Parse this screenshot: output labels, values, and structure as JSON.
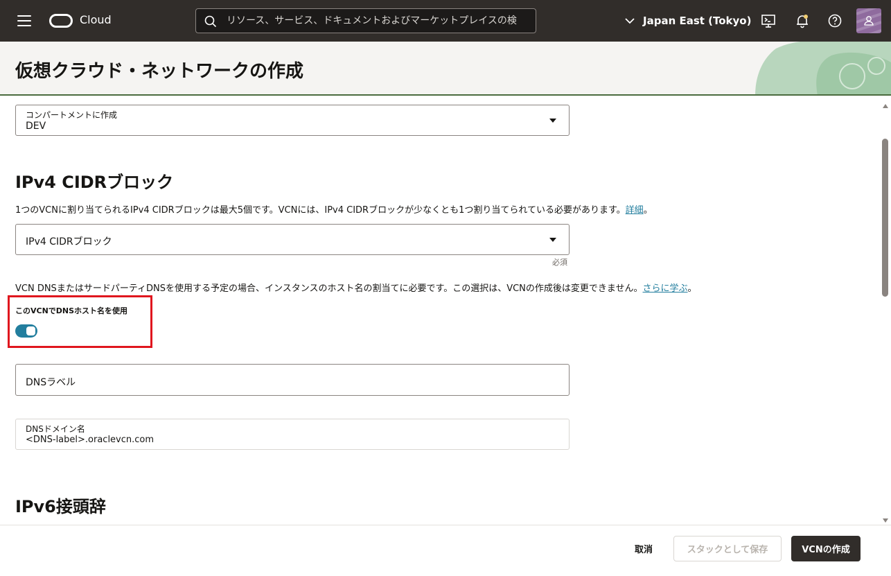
{
  "topbar": {
    "brand": "Cloud",
    "search_placeholder": "リソース、サービス、ドキュメントおよびマーケットプレイスの検",
    "region": "Japan East (Tokyo)"
  },
  "page": {
    "title": "仮想クラウド・ネットワークの作成"
  },
  "form": {
    "compartment": {
      "label": "コンパートメントに作成",
      "value": "DEV"
    },
    "ipv4": {
      "heading": "IPv4 CIDRブロック",
      "help": "1つのVCNに割り当てられるIPv4 CIDRブロックは最大5個です。VCNには、IPv4 CIDRブロックが少なくとも1つ割り当てられている必要があります。",
      "help_link": "詳細",
      "help_suffix": "。",
      "select_placeholder": "IPv4 CIDRブロック",
      "required_label": "必須"
    },
    "dns": {
      "help": "VCN DNSまたはサードパーティDNSを使用する予定の場合、インスタンスのホスト名の割当てに必要です。この選択は、VCNの作成後は変更できません。",
      "help_link": "さらに学ぶ",
      "help_suffix": "。",
      "toggle_label": "このVCNでDNSホスト名を使用",
      "toggle_on": true,
      "label_placeholder": "DNSラベル",
      "domain_label": "DNSドメイン名",
      "domain_value": "<DNS-label>.oraclevcn.com"
    },
    "ipv6": {
      "heading": "IPv6接頭辞"
    }
  },
  "footer": {
    "cancel": "取消",
    "save_as_stack": "スタックとして保存",
    "create": "VCNの作成"
  },
  "colors": {
    "topbar": "#312d2a",
    "accent": "#227e9e",
    "highlight": "#e0161e"
  }
}
